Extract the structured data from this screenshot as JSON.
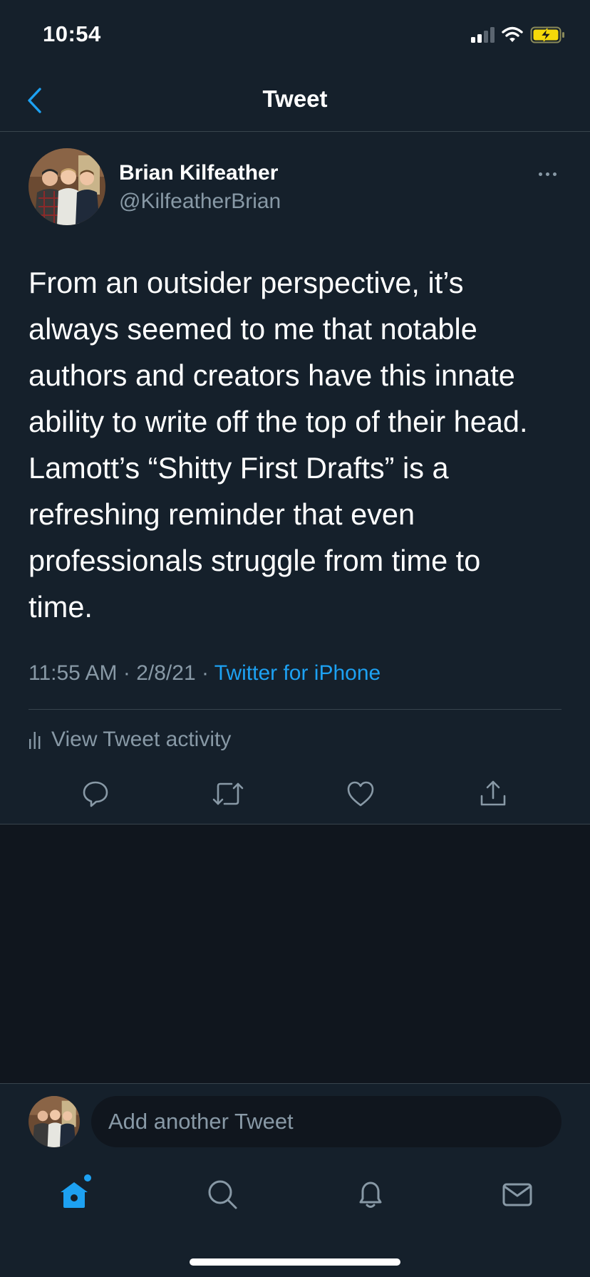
{
  "status_bar": {
    "time": "10:54"
  },
  "header": {
    "title": "Tweet"
  },
  "tweet": {
    "author_name": "Brian Kilfeather",
    "author_handle": "@KilfeatherBrian",
    "text": "From an outsider perspective, it’s\nalways seemed to me that notable\nauthors and creators have this innate\nability to write off the top of their head.\nLamott’s “Shitty First Drafts” is a\nrefreshing reminder that even\nprofessionals struggle from time to\ntime.",
    "time": "11:55 AM",
    "date": "2/8/21",
    "separator": "·",
    "source": "Twitter for iPhone",
    "activity_label": "View Tweet activity"
  },
  "actions": [
    "reply-icon",
    "retweet-icon",
    "like-icon",
    "share-icon"
  ],
  "reply": {
    "placeholder": "Add another Tweet"
  },
  "tab_bar": [
    "home-icon",
    "search-icon",
    "notifications-icon",
    "messages-icon"
  ],
  "colors": {
    "background": "#15202b",
    "accent": "#1da1f2",
    "secondary_text": "#8899a6",
    "divider": "#38444d",
    "empty_area": "#10161e"
  }
}
